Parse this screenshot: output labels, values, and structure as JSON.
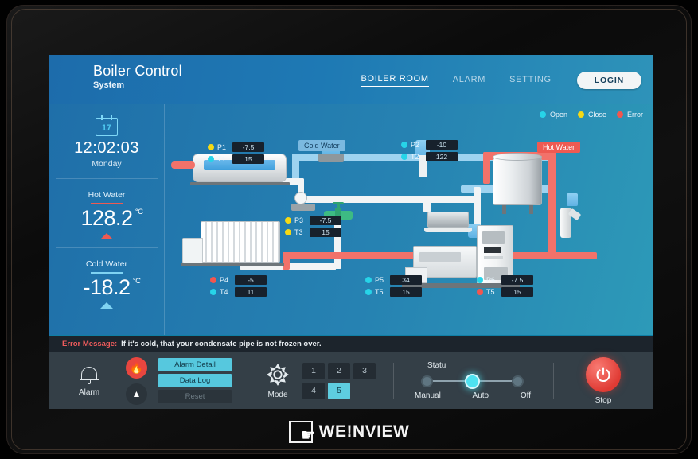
{
  "header": {
    "title": "Boiler Control",
    "subtitle": "System",
    "nav": [
      {
        "label": "BOILER ROOM",
        "active": true
      },
      {
        "label": "ALARM",
        "active": false
      },
      {
        "label": "SETTING",
        "active": false
      }
    ],
    "login_label": "LOGIN"
  },
  "left_panel": {
    "calendar_day": "17",
    "clock": "12:02:03",
    "weekday": "Monday",
    "gauges": [
      {
        "label": "Hot Water",
        "value": "128.2",
        "unit": "°C",
        "accent": "#ee5a52",
        "arrow": "up",
        "arrow_color": "#ee5a52"
      },
      {
        "label": "Cold Water",
        "value": "-18.2",
        "unit": "°C",
        "accent": "#7fd3f2",
        "arrow": "up",
        "arrow_color": "#7fd3f2"
      }
    ]
  },
  "diagram": {
    "legend": [
      {
        "label": "Open",
        "color": "#27d4e8"
      },
      {
        "label": "Close",
        "color": "#f5d915"
      },
      {
        "label": "Error",
        "color": "#f2564f"
      }
    ],
    "pipe_labels": [
      {
        "text": "Cold Water",
        "kind": "cold"
      },
      {
        "text": "Hot Water",
        "kind": "hot"
      }
    ],
    "tags": [
      {
        "group": "g1",
        "rows": [
          {
            "name": "P1",
            "value": "-7.5",
            "state": "close"
          },
          {
            "name": "T1",
            "value": "15",
            "state": "open"
          }
        ]
      },
      {
        "group": "g2",
        "rows": [
          {
            "name": "P2",
            "value": "-10",
            "state": "open"
          },
          {
            "name": "T2",
            "value": "122",
            "state": "open"
          }
        ]
      },
      {
        "group": "g3",
        "rows": [
          {
            "name": "P3",
            "value": "-7.5",
            "state": "close"
          },
          {
            "name": "T3",
            "value": "15",
            "state": "close"
          }
        ]
      },
      {
        "group": "g4",
        "rows": [
          {
            "name": "P4",
            "value": "-5",
            "state": "error"
          },
          {
            "name": "T4",
            "value": "11",
            "state": "open"
          }
        ]
      },
      {
        "group": "g5",
        "rows": [
          {
            "name": "P5",
            "value": "34",
            "state": "open"
          },
          {
            "name": "T5",
            "value": "15",
            "state": "open"
          }
        ]
      },
      {
        "group": "g6",
        "rows": [
          {
            "name": "P6",
            "value": "-7.5",
            "state": "open"
          },
          {
            "name": "T5",
            "value": "15",
            "state": "error"
          }
        ]
      }
    ]
  },
  "error_bar": {
    "label": "Error Message:",
    "message": "If it's cold, that your condensate pipe is not frozen over."
  },
  "toolbar": {
    "alarm_caption": "Alarm",
    "fire_icon": "fire-icon",
    "cone_icon": "cone-icon",
    "buttons": [
      {
        "label": "Alarm Detail",
        "state": "active"
      },
      {
        "label": "Data Log",
        "state": "active"
      },
      {
        "label": "Reset",
        "state": "disabled"
      }
    ],
    "mode_caption": "Mode",
    "modes": [
      {
        "label": "1",
        "selected": false
      },
      {
        "label": "2",
        "selected": false
      },
      {
        "label": "3",
        "selected": false
      },
      {
        "label": "4",
        "selected": false
      },
      {
        "label": "5",
        "selected": true
      }
    ],
    "status_title": "Statu",
    "status_options": [
      {
        "label": "Manual",
        "selected": false
      },
      {
        "label": "Auto",
        "selected": true
      },
      {
        "label": "Off",
        "selected": false
      }
    ],
    "stop_caption": "Stop"
  },
  "brand": {
    "text": "WE!NVIEW"
  }
}
